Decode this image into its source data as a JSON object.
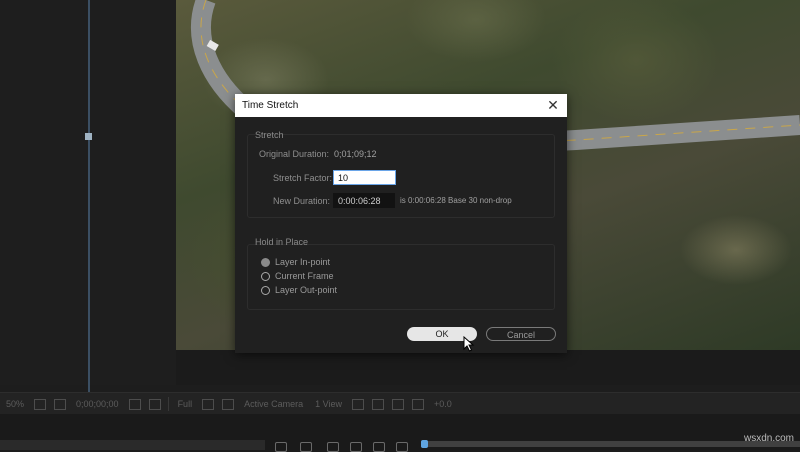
{
  "dialog": {
    "title": "Time Stretch",
    "stretch": {
      "group_label": "Stretch",
      "original_duration_label": "Original Duration:",
      "original_duration_value": "0;01;09;12",
      "stretch_factor_label": "Stretch Factor:",
      "stretch_factor_value": "10",
      "new_duration_label": "New Duration:",
      "new_duration_value": "0:00:06:28",
      "new_duration_note": "is 0:00:06:28  Base 30  non-drop"
    },
    "hold": {
      "group_label": "Hold in Place",
      "options": [
        "Layer In-point",
        "Current Frame",
        "Layer Out-point"
      ],
      "selected": "Layer In-point"
    },
    "ok_label": "OK",
    "cancel_label": "Cancel"
  },
  "toolbar": {
    "zoom": "50%",
    "timecode": "0;00;00;00",
    "resolution": "Full",
    "camera": "Active Camera",
    "views": "1 View",
    "exposure": "+0.0"
  },
  "watermark": "wsxdn.com",
  "icons": {
    "close": "close-icon",
    "cursor": "mouse-pointer-icon"
  }
}
